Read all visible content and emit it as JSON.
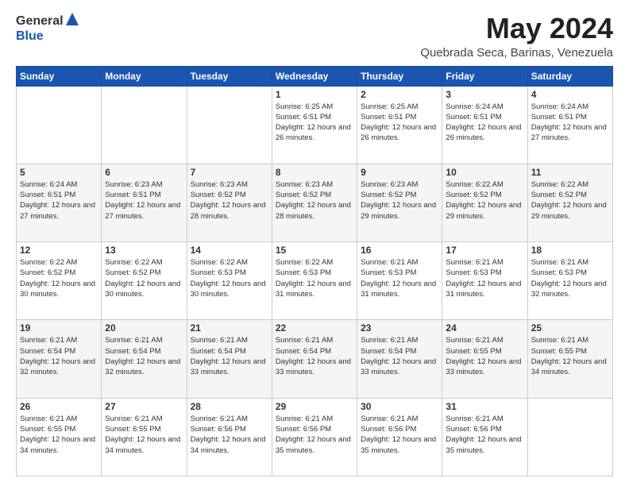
{
  "logo": {
    "general": "General",
    "blue": "Blue"
  },
  "title": "May 2024",
  "location": "Quebrada Seca, Barinas, Venezuela",
  "days_header": [
    "Sunday",
    "Monday",
    "Tuesday",
    "Wednesday",
    "Thursday",
    "Friday",
    "Saturday"
  ],
  "weeks": [
    [
      {
        "day": "",
        "sunrise": "",
        "sunset": "",
        "daylight": ""
      },
      {
        "day": "",
        "sunrise": "",
        "sunset": "",
        "daylight": ""
      },
      {
        "day": "",
        "sunrise": "",
        "sunset": "",
        "daylight": ""
      },
      {
        "day": "1",
        "sunrise": "Sunrise: 6:25 AM",
        "sunset": "Sunset: 6:51 PM",
        "daylight": "Daylight: 12 hours and 26 minutes."
      },
      {
        "day": "2",
        "sunrise": "Sunrise: 6:25 AM",
        "sunset": "Sunset: 6:51 PM",
        "daylight": "Daylight: 12 hours and 26 minutes."
      },
      {
        "day": "3",
        "sunrise": "Sunrise: 6:24 AM",
        "sunset": "Sunset: 6:51 PM",
        "daylight": "Daylight: 12 hours and 26 minutes."
      },
      {
        "day": "4",
        "sunrise": "Sunrise: 6:24 AM",
        "sunset": "Sunset: 6:51 PM",
        "daylight": "Daylight: 12 hours and 27 minutes."
      }
    ],
    [
      {
        "day": "5",
        "sunrise": "Sunrise: 6:24 AM",
        "sunset": "Sunset: 6:51 PM",
        "daylight": "Daylight: 12 hours and 27 minutes."
      },
      {
        "day": "6",
        "sunrise": "Sunrise: 6:23 AM",
        "sunset": "Sunset: 6:51 PM",
        "daylight": "Daylight: 12 hours and 27 minutes."
      },
      {
        "day": "7",
        "sunrise": "Sunrise: 6:23 AM",
        "sunset": "Sunset: 6:52 PM",
        "daylight": "Daylight: 12 hours and 28 minutes."
      },
      {
        "day": "8",
        "sunrise": "Sunrise: 6:23 AM",
        "sunset": "Sunset: 6:52 PM",
        "daylight": "Daylight: 12 hours and 28 minutes."
      },
      {
        "day": "9",
        "sunrise": "Sunrise: 6:23 AM",
        "sunset": "Sunset: 6:52 PM",
        "daylight": "Daylight: 12 hours and 29 minutes."
      },
      {
        "day": "10",
        "sunrise": "Sunrise: 6:22 AM",
        "sunset": "Sunset: 6:52 PM",
        "daylight": "Daylight: 12 hours and 29 minutes."
      },
      {
        "day": "11",
        "sunrise": "Sunrise: 6:22 AM",
        "sunset": "Sunset: 6:52 PM",
        "daylight": "Daylight: 12 hours and 29 minutes."
      }
    ],
    [
      {
        "day": "12",
        "sunrise": "Sunrise: 6:22 AM",
        "sunset": "Sunset: 6:52 PM",
        "daylight": "Daylight: 12 hours and 30 minutes."
      },
      {
        "day": "13",
        "sunrise": "Sunrise: 6:22 AM",
        "sunset": "Sunset: 6:52 PM",
        "daylight": "Daylight: 12 hours and 30 minutes."
      },
      {
        "day": "14",
        "sunrise": "Sunrise: 6:22 AM",
        "sunset": "Sunset: 6:53 PM",
        "daylight": "Daylight: 12 hours and 30 minutes."
      },
      {
        "day": "15",
        "sunrise": "Sunrise: 6:22 AM",
        "sunset": "Sunset: 6:53 PM",
        "daylight": "Daylight: 12 hours and 31 minutes."
      },
      {
        "day": "16",
        "sunrise": "Sunrise: 6:21 AM",
        "sunset": "Sunset: 6:53 PM",
        "daylight": "Daylight: 12 hours and 31 minutes."
      },
      {
        "day": "17",
        "sunrise": "Sunrise: 6:21 AM",
        "sunset": "Sunset: 6:53 PM",
        "daylight": "Daylight: 12 hours and 31 minutes."
      },
      {
        "day": "18",
        "sunrise": "Sunrise: 6:21 AM",
        "sunset": "Sunset: 6:53 PM",
        "daylight": "Daylight: 12 hours and 32 minutes."
      }
    ],
    [
      {
        "day": "19",
        "sunrise": "Sunrise: 6:21 AM",
        "sunset": "Sunset: 6:54 PM",
        "daylight": "Daylight: 12 hours and 32 minutes."
      },
      {
        "day": "20",
        "sunrise": "Sunrise: 6:21 AM",
        "sunset": "Sunset: 6:54 PM",
        "daylight": "Daylight: 12 hours and 32 minutes."
      },
      {
        "day": "21",
        "sunrise": "Sunrise: 6:21 AM",
        "sunset": "Sunset: 6:54 PM",
        "daylight": "Daylight: 12 hours and 33 minutes."
      },
      {
        "day": "22",
        "sunrise": "Sunrise: 6:21 AM",
        "sunset": "Sunset: 6:54 PM",
        "daylight": "Daylight: 12 hours and 33 minutes."
      },
      {
        "day": "23",
        "sunrise": "Sunrise: 6:21 AM",
        "sunset": "Sunset: 6:54 PM",
        "daylight": "Daylight: 12 hours and 33 minutes."
      },
      {
        "day": "24",
        "sunrise": "Sunrise: 6:21 AM",
        "sunset": "Sunset: 6:55 PM",
        "daylight": "Daylight: 12 hours and 33 minutes."
      },
      {
        "day": "25",
        "sunrise": "Sunrise: 6:21 AM",
        "sunset": "Sunset: 6:55 PM",
        "daylight": "Daylight: 12 hours and 34 minutes."
      }
    ],
    [
      {
        "day": "26",
        "sunrise": "Sunrise: 6:21 AM",
        "sunset": "Sunset: 6:55 PM",
        "daylight": "Daylight: 12 hours and 34 minutes."
      },
      {
        "day": "27",
        "sunrise": "Sunrise: 6:21 AM",
        "sunset": "Sunset: 6:55 PM",
        "daylight": "Daylight: 12 hours and 34 minutes."
      },
      {
        "day": "28",
        "sunrise": "Sunrise: 6:21 AM",
        "sunset": "Sunset: 6:56 PM",
        "daylight": "Daylight: 12 hours and 34 minutes."
      },
      {
        "day": "29",
        "sunrise": "Sunrise: 6:21 AM",
        "sunset": "Sunset: 6:56 PM",
        "daylight": "Daylight: 12 hours and 35 minutes."
      },
      {
        "day": "30",
        "sunrise": "Sunrise: 6:21 AM",
        "sunset": "Sunset: 6:56 PM",
        "daylight": "Daylight: 12 hours and 35 minutes."
      },
      {
        "day": "31",
        "sunrise": "Sunrise: 6:21 AM",
        "sunset": "Sunset: 6:56 PM",
        "daylight": "Daylight: 12 hours and 35 minutes."
      },
      {
        "day": "",
        "sunrise": "",
        "sunset": "",
        "daylight": ""
      }
    ]
  ]
}
